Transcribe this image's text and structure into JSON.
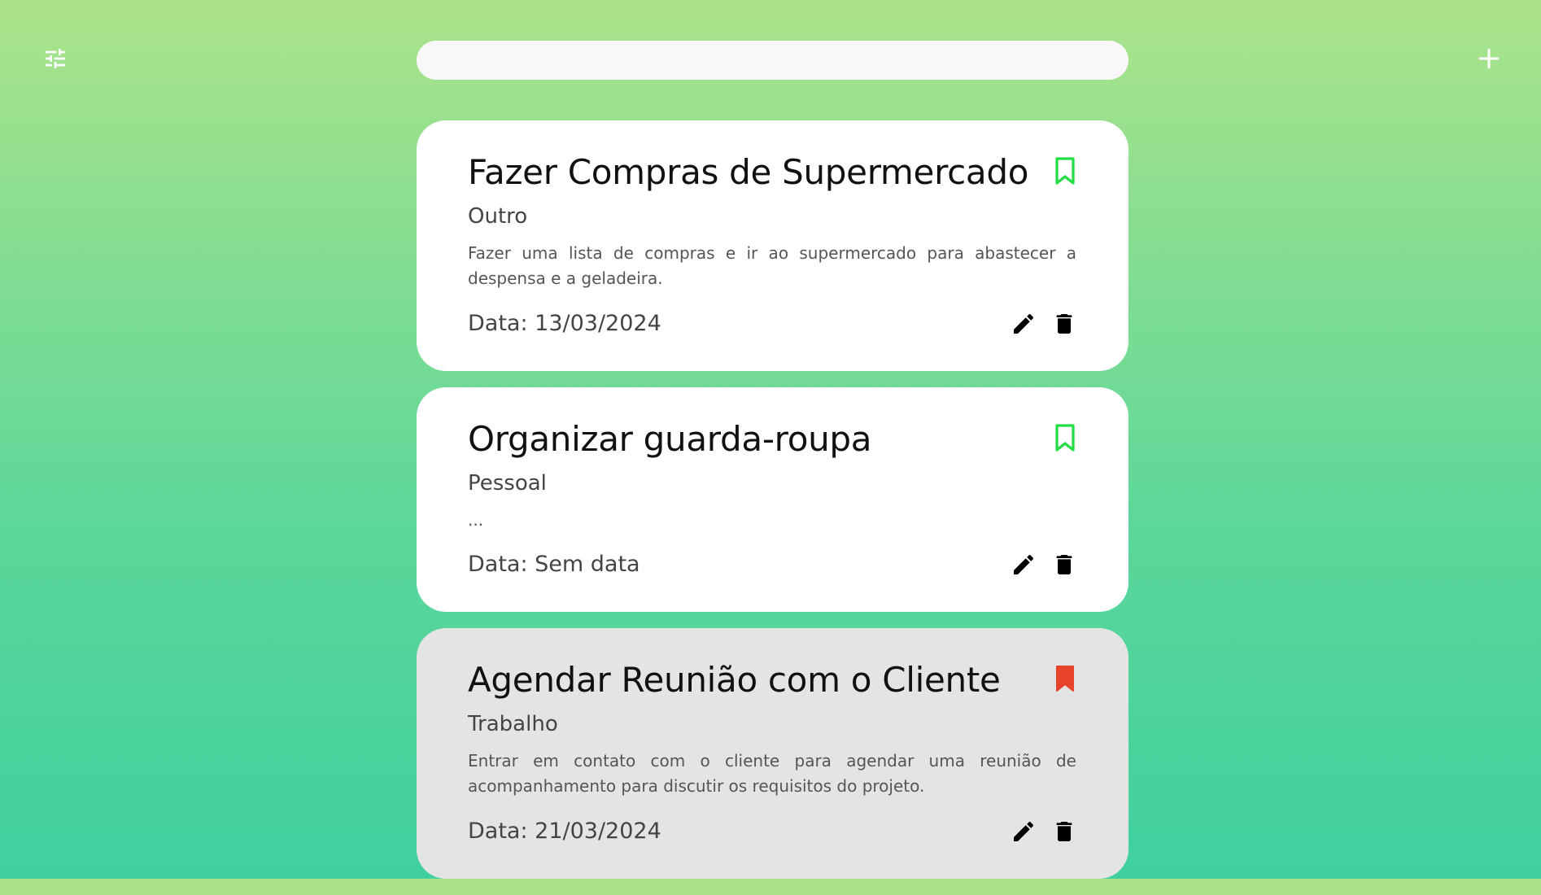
{
  "toolbar": {
    "filter_icon": "tune-icon",
    "add_icon": "plus-icon"
  },
  "search": {
    "value": "",
    "placeholder": ""
  },
  "colors": {
    "bookmark_inactive": "#22dd44",
    "bookmark_active": "#e8432d",
    "card_default": "#ffffff",
    "card_highlight": "#e4e4e4"
  },
  "tasks": [
    {
      "title": "Fazer Compras de Supermercado",
      "category": "Outro",
      "description": "Fazer uma lista de compras e ir ao supermercado para abastecer a despensa e a geladeira.",
      "date": "Data: 13/03/2024",
      "bookmarked": false
    },
    {
      "title": "Organizar guarda-roupa",
      "category": "Pessoal",
      "description": "...",
      "date": "Data: Sem data",
      "bookmarked": false
    },
    {
      "title": "Agendar Reunião com o Cliente",
      "category": "Trabalho",
      "description": "Entrar em contato com o cliente para agendar uma reunião de acompanhamento para discutir os requisitos do projeto.",
      "date": "Data: 21/03/2024",
      "bookmarked": true
    }
  ]
}
